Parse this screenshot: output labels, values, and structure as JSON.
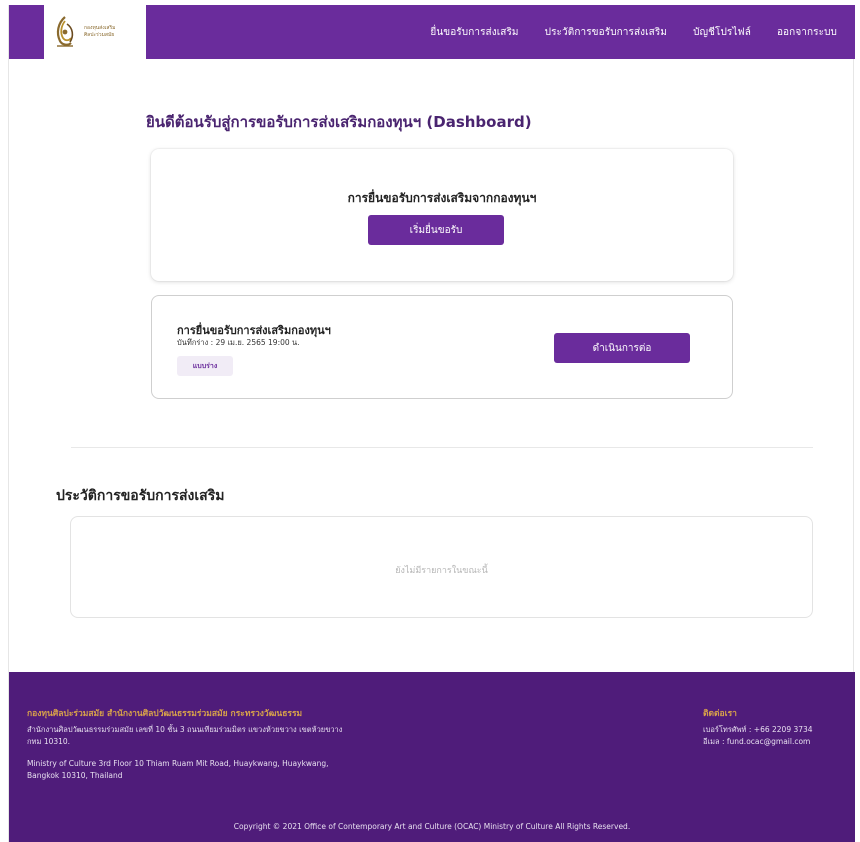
{
  "colors": {
    "brand_purple": "#6a2c9c",
    "footer_purple": "#4f1c7a",
    "gold_accent": "#d8a24a"
  },
  "header": {
    "logo_icon": "ocac-fund-logo-icon",
    "logo_text_line1": "กองทุนส่งเสริม",
    "logo_text_line2": "ศิลปะร่วมสมัย",
    "nav": {
      "submit": "ยื่นขอรับการส่งเสริม",
      "history": "ประวัติการขอรับการส่งเสริม",
      "profile": "บัญชีโปรไฟล์",
      "logout": "ออกจากระบบ"
    }
  },
  "main": {
    "welcome": "ยินดีต้อนรับสู่การขอรับการส่งเสริมกองทุนฯ (Dashboard)",
    "start_card": {
      "title": "การยื่นขอรับการส่งเสริมจากกองทุนฯ",
      "button": "เริ่มยื่นขอรับ"
    },
    "draft_card": {
      "title": "การยื่นขอรับการส่งเสริมกองทุนฯ",
      "saved_at": "บันทึกร่าง : 29 เม.ย. 2565 19:00 น.",
      "status_badge": "แบบร่าง",
      "button": "ดำเนินการต่อ"
    },
    "history": {
      "title": "ประวัติการขอรับการส่งเสริม",
      "empty": "ยังไม่มีรายการในขณะนี้"
    }
  },
  "footer": {
    "org": "กองทุนศิลปะร่วมสมัย สำนักงานศิลปวัฒนธรรมร่วมสมัย กระทรวงวัฒนธรรม",
    "address_th": "สำนักงานศิลปวัฒนธรรมร่วมสมัย เลขที่ 10 ชั้น 3 ถนนเทียมร่วมมิตร แขวงห้วยขวาง เขตห้วยขวาง กทม 10310.",
    "address_en": "Ministry of Culture 3rd Floor 10 Thiam Ruam Mit Road, Huaykwang, Huaykwang, Bangkok 10310, Thailand",
    "contact_heading": "ติดต่อเรา",
    "phone": "เบอร์โทรศัพท์ : +66 2209 3734",
    "email": "อีเมล : fund.ocac@gmail.com",
    "copyright": "Copyright © 2021 Office of Contemporary Art and Culture (OCAC) Ministry of Culture All Rights Reserved."
  }
}
